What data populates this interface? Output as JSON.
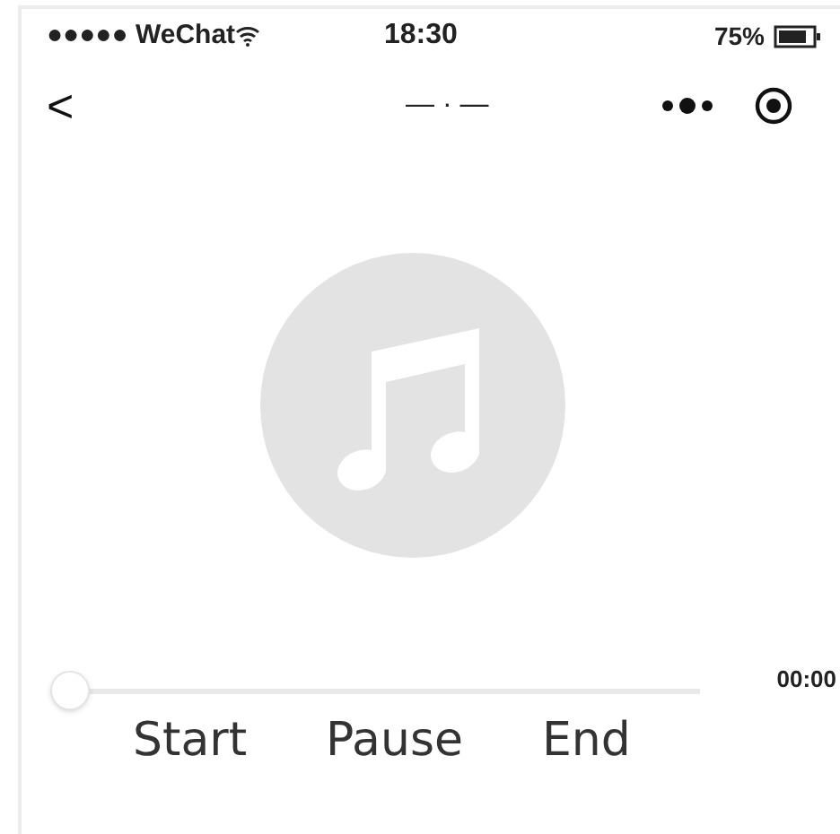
{
  "status_bar": {
    "carrier": "●●●●● WeChat",
    "time": "18:30",
    "battery": "75%"
  },
  "nav": {
    "back": "<",
    "title": "— · —"
  },
  "player": {
    "progress": {
      "level": 0
    },
    "elapsed": "00:00"
  },
  "buttons": [
    "Start",
    "Pause",
    "End"
  ]
}
